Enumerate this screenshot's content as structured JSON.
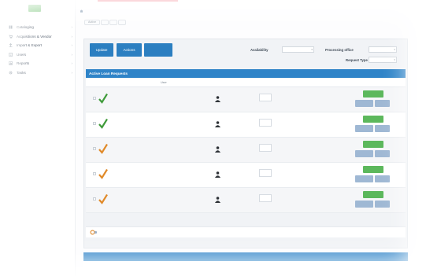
{
  "app": {
    "brand_color": "#5cb85c",
    "accent_color": "#2f84c8",
    "alert_color": "#e4001c"
  },
  "sidebar": {
    "logo_text": "",
    "items": [
      {
        "label": "Cataloging",
        "icon": "book-icon"
      },
      {
        "label": "Acquisitions & Vendor",
        "icon": "cart-icon"
      },
      {
        "label": "Import & Export",
        "icon": "arrows-icon"
      },
      {
        "label": "Users",
        "icon": "user-icon"
      },
      {
        "label": "Reports",
        "icon": "chart-icon"
      },
      {
        "label": "Tasks",
        "icon": "gear-icon"
      }
    ]
  },
  "breadcrumb": {
    "current": "",
    "sub": ""
  },
  "subtabs": [
    "Active",
    "",
    "",
    ""
  ],
  "toolbar": {
    "button1": "Update",
    "button2": "Actions",
    "button3": "",
    "availability_label": "Availability",
    "availability_value": "",
    "processing_label": "Processing office",
    "processing_value": "",
    "request_type_label": "Request Type",
    "request_type_value": ""
  },
  "active_loans": {
    "title": "Active Loan Requests",
    "columns": [
      "",
      "",
      "User",
      "",
      "",
      "",
      "",
      "",
      ""
    ],
    "rows": [
      {
        "check": "green",
        "title": "",
        "user": "",
        "qty": "",
        "datetype": "",
        "action_small": "",
        "status": "",
        "act1": "",
        "act2": "",
        "act3": ""
      },
      {
        "check": "green",
        "title": "",
        "user": "",
        "qty": "",
        "datetype": "",
        "action_small": "",
        "status": "",
        "act1": "",
        "act2": "",
        "act3": ""
      },
      {
        "check": "orange",
        "title": "",
        "user": "",
        "qty": "",
        "datetype": "",
        "action_small": "",
        "status": "",
        "act1": "",
        "act2": "",
        "act3": ""
      },
      {
        "check": "orange",
        "title": "",
        "user": "",
        "qty": "",
        "datetype": "",
        "action_small": "",
        "status": "",
        "act1": "",
        "act2": "",
        "act3": ""
      },
      {
        "check": "orange",
        "title": "",
        "user": "",
        "qty": "",
        "datetype": "",
        "action_small": "",
        "status": "",
        "act1": "",
        "act2": "",
        "act3": ""
      }
    ]
  },
  "pager": {
    "controls": "",
    "view": ""
  },
  "active_other": {
    "title": ""
  }
}
